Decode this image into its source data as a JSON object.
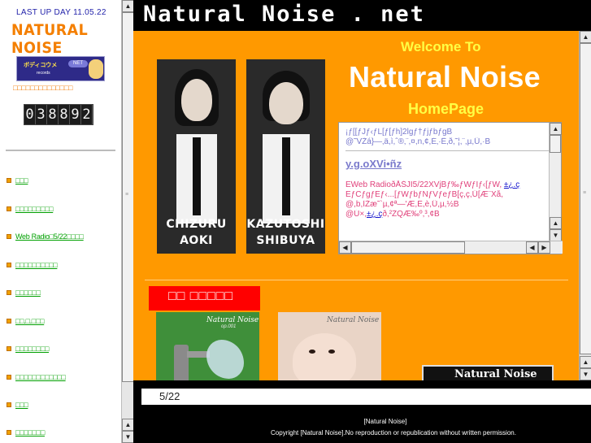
{
  "left": {
    "last_up": "LAST UP DAY 11.05.22",
    "logo": "NATURAL NOISE",
    "banner": {
      "title": "ボディコウメ",
      "badge": "NET",
      "subtitle": "records"
    },
    "banner_caption": "□□□□□□□□□□□□□□",
    "counter_digits": [
      "0",
      "3",
      "8",
      "8",
      "9",
      "2"
    ],
    "nav": [
      {
        "label": "□□□"
      },
      {
        "label": "□□□□□□□□□"
      },
      {
        "label": "Web Radio□5/22□□□□"
      },
      {
        "label": "□□□□□□□□□□"
      },
      {
        "label": "□□□□□□"
      },
      {
        "label": "□□.□.□□□"
      },
      {
        "label": "□□□□□□□□"
      },
      {
        "label": "□□□□□□□□□□□□"
      },
      {
        "label": "□□□"
      },
      {
        "label": "□□□□□□□"
      }
    ]
  },
  "header": {
    "site_title": "Natural Noise . net"
  },
  "main": {
    "welcome": "Welcome To",
    "title": "Natural Noise",
    "homepage": "HomePage",
    "members": [
      {
        "first": "CHIZURU",
        "last": "AOKI"
      },
      {
        "first": "KAZUTOSHI",
        "last": "SHIBUYA"
      }
    ],
    "news": {
      "line1": "¡ƒ[[ƒJƒ‹ƒL[ƒ[ƒh]2lgƒ†ƒjƒbƒgB",
      "line2": "@˜VŽá}—‚ä,ì,ˆ®‚¨,¤,n,¢,É‚·Ë‚ð,˜¦,¨,µ,Ü,·B",
      "heading": "y.g.oXVi•ñz",
      "line3": "EWeb RadioðÅŠJI5/22XVjBƒ‰ƒWƒIƒ‹[ƒW,",
      "link1": "±¿.ç",
      "line4": "EƒCƒgƒEƒ‹...[ƒWƒbƒNƒVƒeƒB[ç,ç,Ü[Æ¨Xå,",
      "line5": "@,b,ÌŽæ˜`µ,¢ª—'Æ,Ê,è,Ü,µ,½B",
      "line6": "@Ú×,",
      "link2": "±¿.ç",
      "line7": "ð,²ŽQÆ‰º,³,¢B"
    },
    "section_title": "□□ □□□□□",
    "covers": [
      {
        "title": "Natural Noise",
        "subtitle": "op.001"
      },
      {
        "title": "Natural Noise",
        "subtitle": ""
      }
    ],
    "side_label": "Natural Noise"
  },
  "ticker": {
    "text": "5/22"
  },
  "footer": {
    "line1": "[Natural Noise]",
    "line2": "Copyright [Natural Noise].No reproduction or republication without written permission."
  },
  "colors": {
    "main_bg": "#ff9900",
    "accent_yellow": "#ffff44",
    "section_red": "#ff0000",
    "nav_green": "#00a000"
  }
}
